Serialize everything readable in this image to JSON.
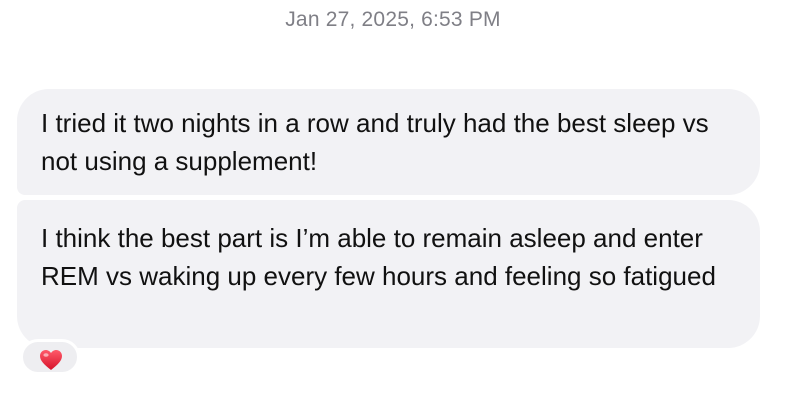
{
  "conversation": {
    "timestamp": "Jan 27, 2025, 6:53 PM",
    "messages": [
      {
        "text": "I tried it two nights in a row and truly had the best sleep vs not using a supplement!"
      },
      {
        "text": "I think the best part is I’m able to remain asleep and enter REM vs waking up every few hours and feeling so fatigued",
        "reaction": {
          "icon": "heart-icon",
          "color": "#e8233a"
        }
      }
    ]
  },
  "colors": {
    "bubble_background": "#f2f2f5",
    "timestamp_text": "#7f7f86",
    "message_text": "#111111"
  }
}
